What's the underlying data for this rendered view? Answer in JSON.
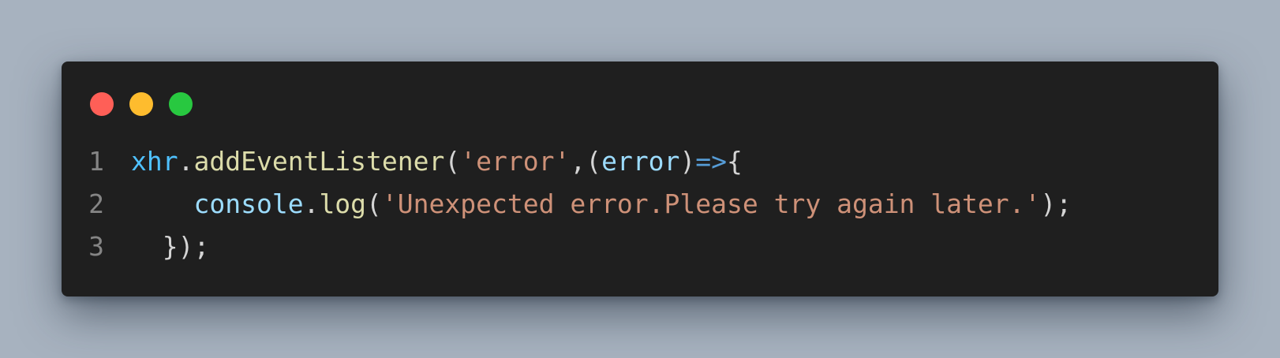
{
  "window": {
    "background": "#1f1f1f",
    "page_background": "#a7b2bf",
    "controls": [
      {
        "name": "close",
        "color": "#ff5f57"
      },
      {
        "name": "minimize",
        "color": "#febc2e"
      },
      {
        "name": "maximize",
        "color": "#28c840"
      }
    ]
  },
  "code": {
    "lines": [
      {
        "number": "1",
        "tokens": [
          {
            "text": "xhr",
            "type": "object"
          },
          {
            "text": ".",
            "type": "plain"
          },
          {
            "text": "addEventListener",
            "type": "method"
          },
          {
            "text": "(",
            "type": "plain"
          },
          {
            "text": "'error'",
            "type": "string"
          },
          {
            "text": ",(",
            "type": "plain"
          },
          {
            "text": "error",
            "type": "param"
          },
          {
            "text": ")",
            "type": "plain"
          },
          {
            "text": "=>",
            "type": "arrow"
          },
          {
            "text": "{",
            "type": "plain"
          }
        ]
      },
      {
        "number": "2",
        "tokens": [
          {
            "text": "    ",
            "type": "plain"
          },
          {
            "text": "console",
            "type": "object2"
          },
          {
            "text": ".",
            "type": "plain"
          },
          {
            "text": "log",
            "type": "method"
          },
          {
            "text": "(",
            "type": "plain"
          },
          {
            "text": "'Unexpected error.Please try again later.'",
            "type": "string"
          },
          {
            "text": ");",
            "type": "plain"
          }
        ]
      },
      {
        "number": "3",
        "tokens": [
          {
            "text": "  ",
            "type": "plain"
          },
          {
            "text": "});",
            "type": "plain"
          }
        ]
      }
    ]
  }
}
